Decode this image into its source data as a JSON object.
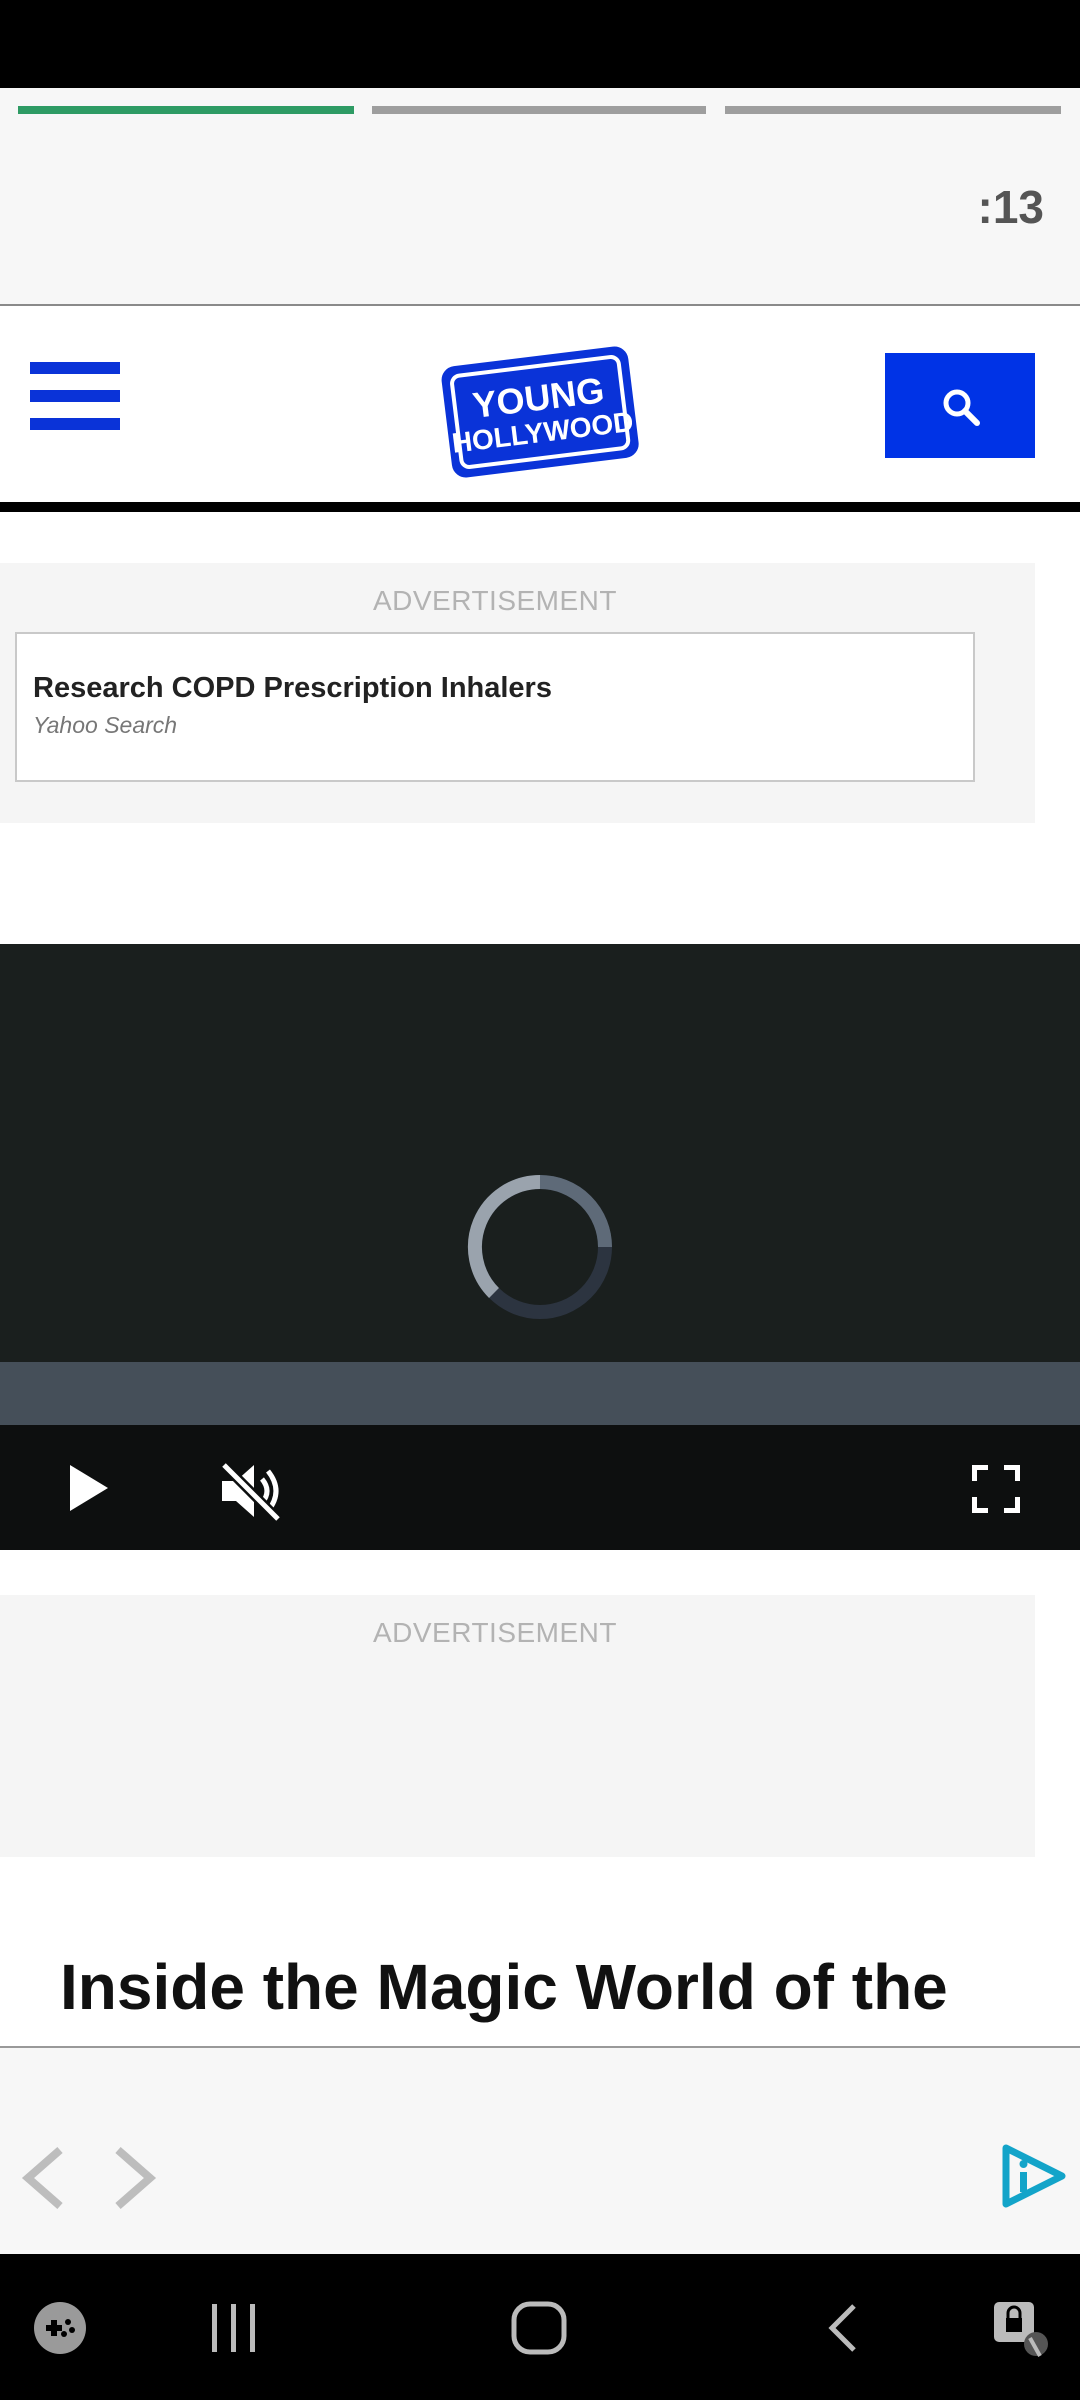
{
  "story": {
    "segments": [
      {
        "state": "active"
      },
      {
        "state": "pending"
      },
      {
        "state": "pending"
      }
    ],
    "timer": ":13",
    "colors": {
      "active_segment": "#2e9b64",
      "pending_segment": "#9e9e9e"
    }
  },
  "header": {
    "logo_line1": "YOUNG",
    "logo_line2": "HOLLYWOOD",
    "menu_icon": "hamburger-menu-icon",
    "search_icon": "search-icon",
    "brand_color": "#0033e6"
  },
  "ad1": {
    "label": "ADVERTISEMENT",
    "title": "Research COPD Prescription Inhalers",
    "source": "Yahoo Search"
  },
  "video": {
    "state": "loading",
    "controls": {
      "play_icon": "play-icon",
      "mute_icon": "muted-speaker-icon",
      "fullscreen_icon": "fullscreen-icon"
    }
  },
  "ad2": {
    "label": "ADVERTISEMENT"
  },
  "article": {
    "headline": "Inside the Magic World of the"
  },
  "bottom_nav": {
    "prev_icon": "chevron-left-icon",
    "next_icon": "chevron-right-icon",
    "brand_icon": "brand-play-icon"
  },
  "system_nav": {
    "icons": [
      "game-launcher-icon",
      "recent-apps-icon",
      "home-icon",
      "back-icon",
      "accessibility-icon"
    ]
  }
}
